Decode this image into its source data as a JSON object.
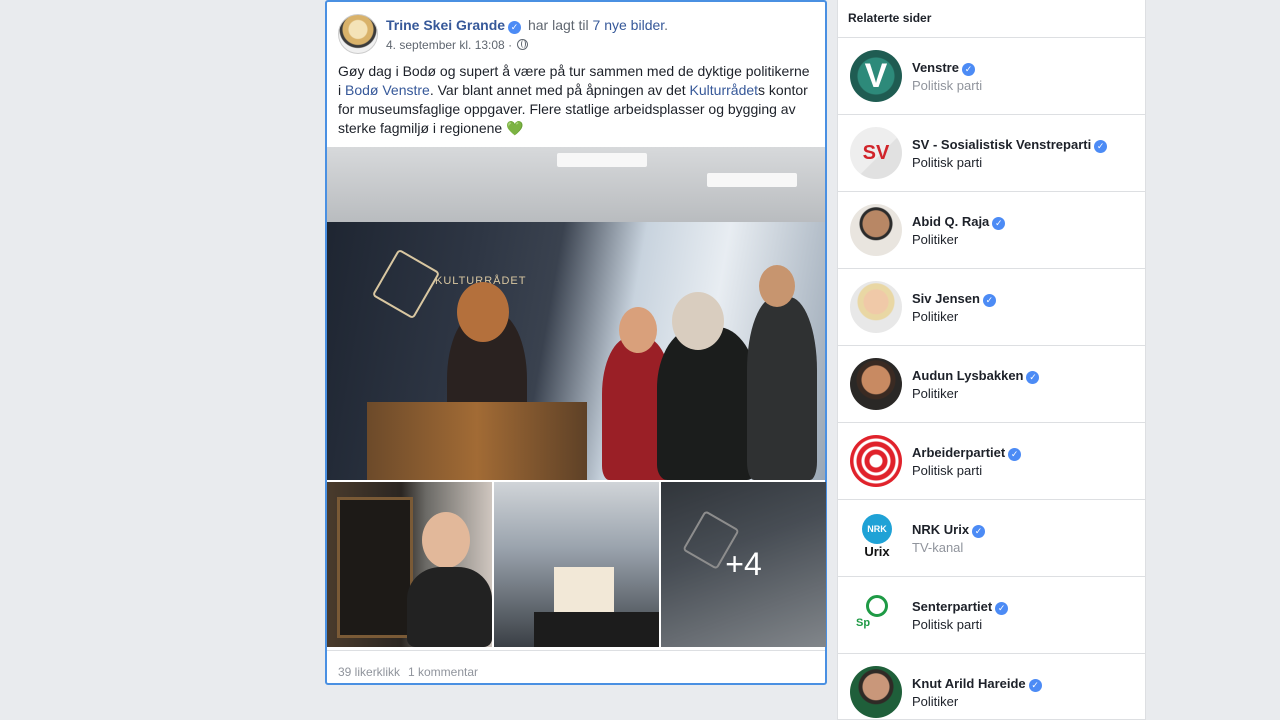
{
  "post": {
    "author": "Trine Skei Grande",
    "action_text": "har lagt til",
    "action_link": "7 nye bilder",
    "action_end": ".",
    "timestamp": "4. september kl. 13:08 ·",
    "text_1": "Gøy dag i Bodø og supert å være på tur sammen med de dyktige politikerne i ",
    "link_1": "Bodø Venstre",
    "text_2": ". Var blant annet med på åpningen av det ",
    "link_2": "Kulturrådet",
    "text_3": "s kontor for museumsfaglige oppgaver. Flere statlige arbeidsplasser og bygging av sterke fagmiljø i regionene ",
    "emoji": "💚",
    "photo_sign": "KULTURRÅDET",
    "more_photos": "+4",
    "likes": "39 likerklikk",
    "comments": "1 kommentar"
  },
  "related": {
    "title": "Relaterte sider",
    "items": [
      {
        "name": "Venstre",
        "category": "Politisk parti",
        "muted": true
      },
      {
        "name": "SV - Sosialistisk Venstreparti",
        "category": "Politisk parti",
        "muted": false
      },
      {
        "name": "Abid Q. Raja",
        "category": "Politiker",
        "muted": false
      },
      {
        "name": "Siv Jensen",
        "category": "Politiker",
        "muted": false
      },
      {
        "name": "Audun Lysbakken",
        "category": "Politiker",
        "muted": false
      },
      {
        "name": "Arbeiderpartiet",
        "category": "Politisk parti",
        "muted": false
      },
      {
        "name": "NRK Urix",
        "category": "TV-kanal",
        "muted": true
      },
      {
        "name": "Senterpartiet",
        "category": "Politisk parti",
        "muted": false
      },
      {
        "name": "Knut Arild Hareide",
        "category": "Politiker",
        "muted": false
      }
    ],
    "avatar_labels": {
      "venstre": "V",
      "sv": "SV",
      "nrk_top": "NRK",
      "nrk_bottom": "Urix",
      "sp": "Sp"
    }
  },
  "colors": {
    "link": "#365899",
    "verified": "#4c8bf5",
    "selection_border": "#4a90e2",
    "background": "#e9ebee"
  }
}
